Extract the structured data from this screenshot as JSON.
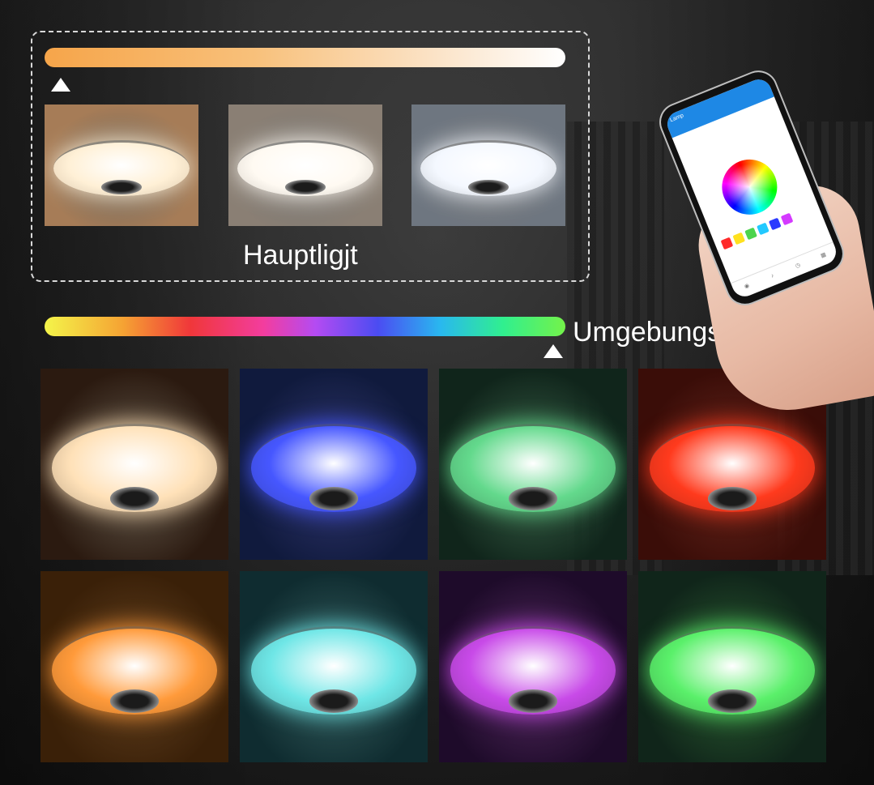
{
  "main_section": {
    "label": "Hauptligjt",
    "bar_colors": [
      "#f6a54a",
      "#fbe3c7",
      "#ffffff"
    ],
    "tiles": [
      {
        "name": "warm",
        "bg": "#a67c57",
        "glow": "#fff0d6"
      },
      {
        "name": "neutral",
        "bg": "#8a7f74",
        "glow": "#fffaf2"
      },
      {
        "name": "cool",
        "bg": "#6e7680",
        "glow": "#f4f8ff"
      }
    ]
  },
  "ambient_section": {
    "label": "Umgebungslicht",
    "tiles": [
      {
        "name": "warm-white",
        "bg": "#2b1a10",
        "glow": "#ffe1b8"
      },
      {
        "name": "blue",
        "bg": "#101a3d",
        "glow": "#4657ff"
      },
      {
        "name": "green",
        "bg": "#10251b",
        "glow": "#63d98c"
      },
      {
        "name": "red",
        "bg": "#3a0d08",
        "glow": "#ff3a1d"
      },
      {
        "name": "orange",
        "bg": "#3a2008",
        "glow": "#ff9a3a"
      },
      {
        "name": "cyan",
        "bg": "#0f2c30",
        "glow": "#6ee6e6"
      },
      {
        "name": "purple",
        "bg": "#1e0b2a",
        "glow": "#c84ae8"
      },
      {
        "name": "lime",
        "bg": "#10251a",
        "glow": "#5af06a"
      }
    ]
  },
  "phone": {
    "app_title": "Lamp",
    "swatch_colors": [
      "#ff2a2a",
      "#ffe11f",
      "#4cd44c",
      "#22c9ff",
      "#2a39ff",
      "#d43aff"
    ],
    "tab_labels": [
      "",
      "",
      "",
      ""
    ]
  }
}
